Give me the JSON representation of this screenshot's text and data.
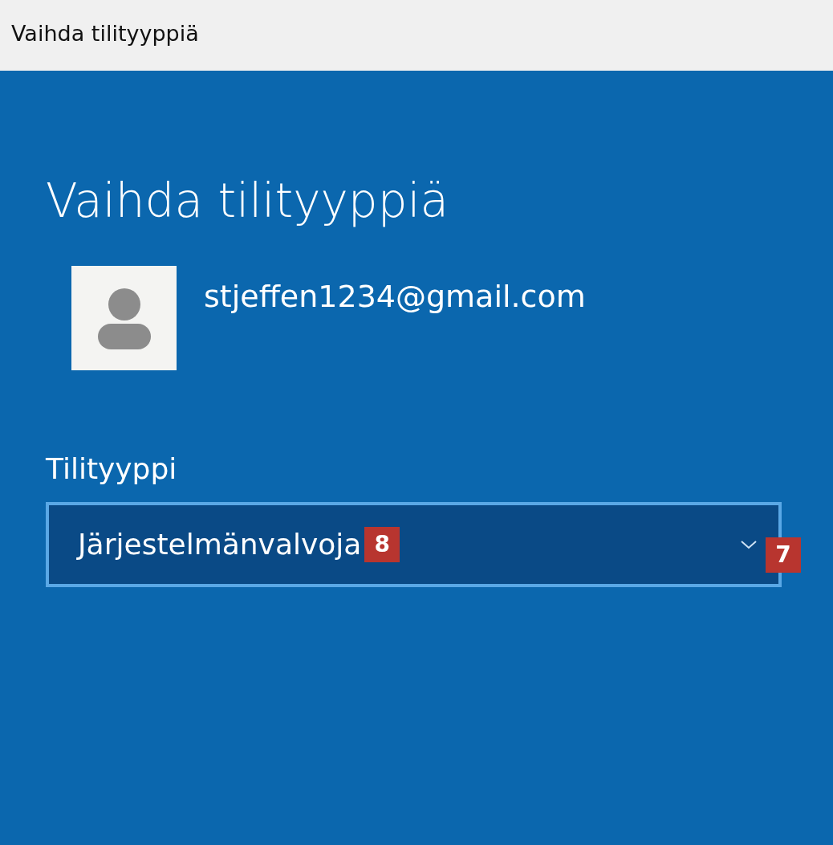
{
  "window": {
    "title": "Vaihda tilityyppiä"
  },
  "page": {
    "heading": "Vaihda tilityyppiä",
    "account": {
      "email": "stjeffen1234@gmail.com"
    },
    "account_type": {
      "label": "Tilityyppi",
      "value": "Järjestelmänvalvoja"
    }
  },
  "annotations": [
    {
      "text": "8"
    },
    {
      "text": "7"
    }
  ]
}
